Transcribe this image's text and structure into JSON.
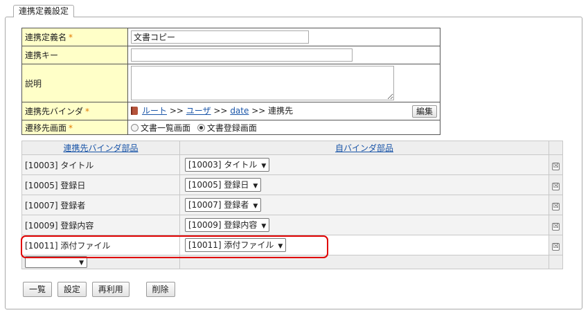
{
  "tab": {
    "label": "連携定義設定"
  },
  "form": {
    "name_label": "連携定義名",
    "name_value": "文書コピー",
    "key_label": "連携キー",
    "key_value": "",
    "desc_label": "説明",
    "desc_value": "",
    "binder_label": "連携先バインダ",
    "binder_path": {
      "root": "ルート",
      "sep1": ">>",
      "user": "ユーザ",
      "sep2": ">>",
      "date": "date",
      "sep3": ">>",
      "current": "連携先"
    },
    "edit_button": "編集",
    "dest_label": "遷移先画面",
    "dest_option_list": "文書一覧画面",
    "dest_option_register": "文書登録画面",
    "dest_selected": "文書登録画面",
    "required_mark": "*"
  },
  "mapping": {
    "header_left": "連携先バインダ部品",
    "header_right": "自バインダ部品",
    "delete_glyph": "☒",
    "arrow": "▼",
    "rows": [
      {
        "left": "[10003] タイトル",
        "right": "[10003] タイトル"
      },
      {
        "left": "[10005] 登録日",
        "right": "[10005] 登録日"
      },
      {
        "left": "[10007] 登録者",
        "right": "[10007] 登録者"
      },
      {
        "left": "[10009] 登録内容",
        "right": "[10009] 登録内容"
      },
      {
        "left": "[10011] 添付ファイル",
        "right": "[10011] 添付ファイル"
      }
    ],
    "new_row_select": ""
  },
  "actions": {
    "list_label": "一覧",
    "set_label": "設定",
    "reuse_label": "再利用",
    "delete_label": "削除"
  },
  "colors": {
    "highlight": "#e00000",
    "header_bg": "#ffffc8",
    "link": "#1a55a8",
    "required": "#e37a00"
  }
}
